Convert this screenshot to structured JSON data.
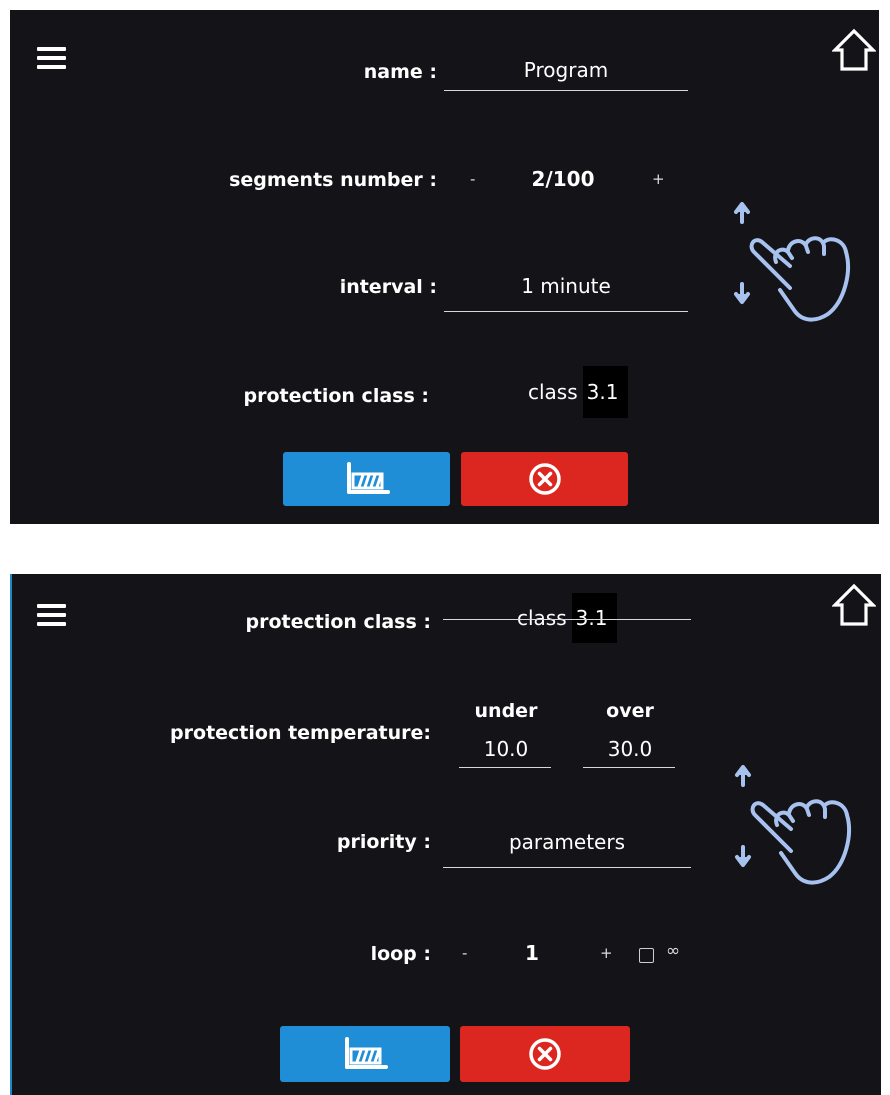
{
  "screen1": {
    "name_label": "name :",
    "name_value": "Program",
    "segments_label": "segments number :",
    "segments_minus": "-",
    "segments_value": "2/100",
    "segments_plus": "+",
    "interval_label": "interval :",
    "interval_value": "1 minute",
    "protection_class_label": "protection class :",
    "class_word": "class",
    "class_value": "3.1"
  },
  "screen2": {
    "protection_class_label": "protection class :",
    "class_word": "class",
    "class_value": "3.1",
    "protection_temp_label": "protection temperature:",
    "under_label": "under",
    "under_value": "10.0",
    "over_label": "over",
    "over_value": "30.0",
    "priority_label": "priority :",
    "priority_value": "parameters",
    "loop_label": "loop :",
    "loop_minus": "-",
    "loop_value": "1",
    "loop_plus": "+",
    "infinity_symbol": "∞"
  },
  "icons": {
    "menu": "menu-icon",
    "home": "home-icon",
    "chart": "chart-icon",
    "cancel": "cancel-icon",
    "scroll_gesture": "swipe-hand-icon"
  },
  "colors": {
    "background": "#141418",
    "accent_blue": "#1f8ed6",
    "cancel_red": "#dc2620",
    "gesture_blue": "#a8c2f0"
  }
}
